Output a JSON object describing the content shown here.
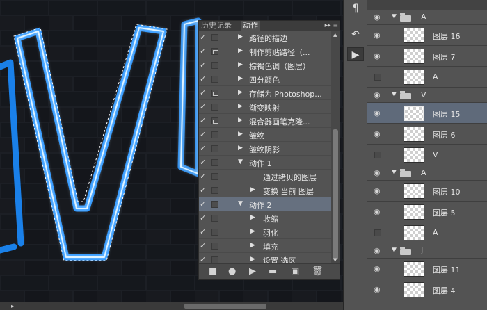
{
  "actions_panel": {
    "tabs": [
      "历史记录",
      "动作"
    ],
    "menu_glyph": "▸▸ ≡",
    "rows": [
      {
        "label": "路径的描边",
        "expand": "right",
        "level": 1,
        "dialog": false
      },
      {
        "label": "制作剪贴路径（...",
        "expand": "right",
        "level": 1,
        "dialog": true
      },
      {
        "label": "棕褐色调（图层）",
        "expand": "right",
        "level": 1,
        "dialog": false
      },
      {
        "label": "四分颜色",
        "expand": "right",
        "level": 1,
        "dialog": false
      },
      {
        "label": "存储为 Photoshop...",
        "expand": "right",
        "level": 1,
        "dialog": true
      },
      {
        "label": "渐变映射",
        "expand": "right",
        "level": 1,
        "dialog": false
      },
      {
        "label": "混合器画笔克隆...",
        "expand": "right",
        "level": 1,
        "dialog": true
      },
      {
        "label": "皱纹",
        "expand": "right",
        "level": 1,
        "dialog": false
      },
      {
        "label": "皱纹阴影",
        "expand": "right",
        "level": 1,
        "dialog": false
      },
      {
        "label": "动作 1",
        "expand": "down",
        "level": 1,
        "dialog": false
      },
      {
        "label": "通过拷贝的图层",
        "expand": "none",
        "level": 2,
        "dialog": false
      },
      {
        "label": "变换 当前 图层",
        "expand": "right",
        "level": 2,
        "dialog": false
      },
      {
        "label": "动作 2",
        "expand": "down",
        "level": 1,
        "dialog": false,
        "selected": true
      },
      {
        "label": "收缩",
        "expand": "right",
        "level": 2,
        "dialog": false
      },
      {
        "label": "羽化",
        "expand": "right",
        "level": 2,
        "dialog": false
      },
      {
        "label": "填充",
        "expand": "right",
        "level": 2,
        "dialog": false
      },
      {
        "label": "设置 选区",
        "expand": "right",
        "level": 2,
        "dialog": false
      }
    ],
    "tool_icons": [
      "stop-icon",
      "record-icon",
      "play-icon",
      "new-set-icon",
      "new-action-icon",
      "delete-icon"
    ]
  },
  "layers": [
    {
      "type": "group",
      "name": "A",
      "visible": true
    },
    {
      "type": "layer",
      "name": "图层 16",
      "visible": true
    },
    {
      "type": "layer",
      "name": "图层 7",
      "visible": true
    },
    {
      "type": "layer",
      "name": "A",
      "visible": false
    },
    {
      "type": "group",
      "name": "V",
      "visible": true
    },
    {
      "type": "layer",
      "name": "图层 15",
      "visible": true,
      "selected": true
    },
    {
      "type": "layer",
      "name": "图层 6",
      "visible": true
    },
    {
      "type": "layer",
      "name": "V",
      "visible": false
    },
    {
      "type": "group",
      "name": "A",
      "visible": true
    },
    {
      "type": "layer",
      "name": "图层 10",
      "visible": true
    },
    {
      "type": "layer",
      "name": "图层 5",
      "visible": true
    },
    {
      "type": "layer",
      "name": "A",
      "visible": false
    },
    {
      "type": "group",
      "name": "J",
      "visible": true
    },
    {
      "type": "layer",
      "name": "图层 11",
      "visible": true
    },
    {
      "type": "layer",
      "name": "图层 4",
      "visible": true
    }
  ],
  "colors": {
    "neon": "#3aa0ff",
    "neon_glow": "#bfe6ff",
    "canvas_bg": "#22252c",
    "panel": "#535353",
    "selection": "#66707f"
  }
}
